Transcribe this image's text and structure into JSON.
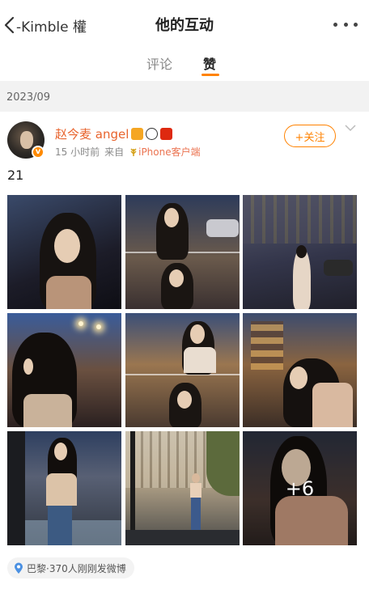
{
  "header": {
    "back_label": "-Kimble 權",
    "title": "他的互动",
    "more_icon": "more-horizontal-icon"
  },
  "tabs": [
    {
      "label": "评论",
      "active": false
    },
    {
      "label": "赞",
      "active": true
    }
  ],
  "accent_color": "#ff8200",
  "date_separator": "2023/09",
  "post": {
    "author_name": "赵今麦 angel",
    "verified_badge": "v",
    "time": "15 小时前",
    "source_prefix": "来自",
    "source_client": "iPhone客户端",
    "follow_label": "+关注",
    "text": "21",
    "photos_more_count": "+6",
    "location": "巴黎·370人刚刚发微博"
  }
}
